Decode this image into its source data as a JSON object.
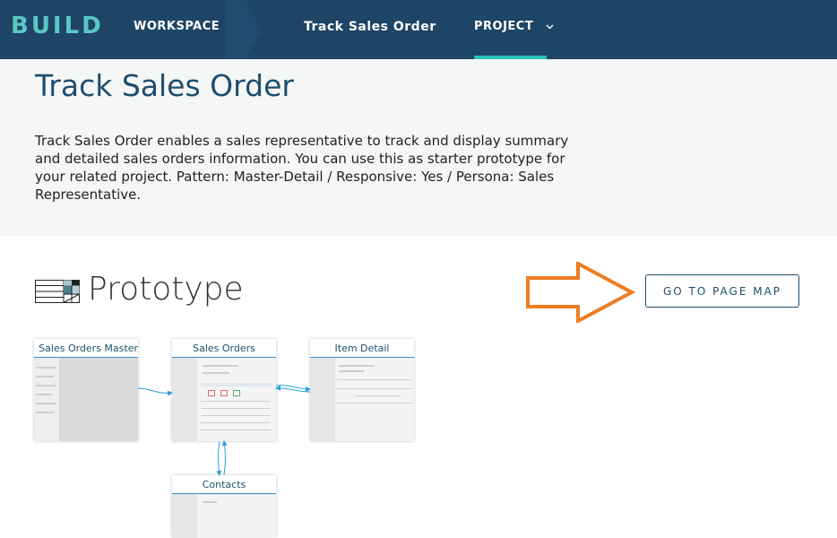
{
  "header": {
    "brand": "BUILD",
    "workspace_label": "WORKSPACE",
    "breadcrumb_label": "Track Sales Order",
    "project_label": "PROJECT",
    "colors": {
      "bar": "#1e4466",
      "brand": "#5bc8c5",
      "active_underline": "#2ac3b7"
    }
  },
  "hero": {
    "title": "Track Sales Order",
    "description": "Track Sales Order enables a sales representative to track and display summary and detailed sales orders information. You can use this as starter prototype for your related project. Pattern: Master-Detail / Responsive: Yes / Persona: Sales Representative."
  },
  "prototype": {
    "section_title": "Prototype",
    "go_to_page_map_label": "GO TO PAGE MAP",
    "arrow_color": "#ef7d22",
    "pages": [
      {
        "title": "Sales Orders Master",
        "icon": "store-icon"
      },
      {
        "title": "Sales Orders"
      },
      {
        "title": "Item Detail"
      },
      {
        "title": "Contacts"
      }
    ]
  }
}
